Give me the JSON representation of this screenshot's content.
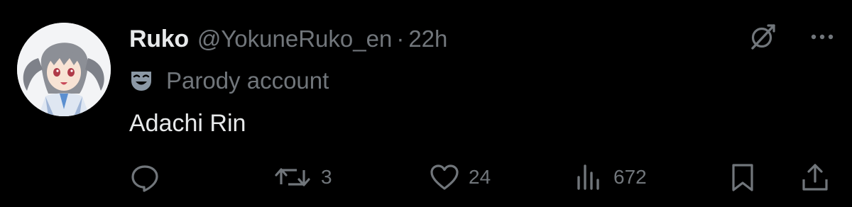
{
  "tweet": {
    "author": {
      "display_name": "Ruko",
      "handle": "@YokuneRuko_en",
      "separator": "·",
      "time_ago": "22h",
      "badge_label": "Parody account"
    },
    "text": "Adachi Rin",
    "stats": {
      "replies": "",
      "reposts": "3",
      "likes": "24",
      "views": "672"
    }
  },
  "icons": {
    "avatar": "avatar-image",
    "badge": "parody-mask-icon",
    "top_right": [
      "grok-icon",
      "more-icon"
    ],
    "actions": [
      "reply-icon",
      "repost-icon",
      "like-icon",
      "views-icon",
      "bookmark-icon",
      "share-icon"
    ]
  },
  "colors": {
    "background": "#000000",
    "primary_text": "#e7e9ea",
    "secondary_text": "#71767b",
    "badge_icon": "#8b98a5"
  }
}
